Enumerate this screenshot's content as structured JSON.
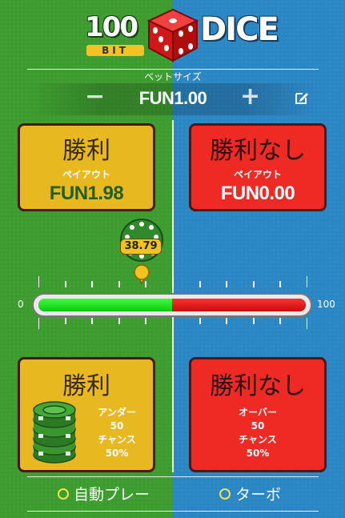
{
  "logo": {
    "number": "100",
    "bit": "BIT",
    "word": "DICE"
  },
  "bet": {
    "label": "ベットサイズ",
    "decrease_label": "−",
    "increase_label": "+",
    "value": "FUN1.00",
    "edit_icon": "edit-icon"
  },
  "win_card": {
    "title": "勝利",
    "payout_label": "ペイアウト",
    "payout_value": "FUN1.98"
  },
  "lose_card": {
    "title": "勝利なし",
    "payout_label": "ペイアウト",
    "payout_value": "FUN0.00"
  },
  "slider": {
    "value": 38.79,
    "value_label": "38.79",
    "min_label": "0",
    "max_label": "100",
    "split_fraction": 0.5,
    "win_color": "#22dd22",
    "lose_color": "#e01818"
  },
  "under_card": {
    "title": "勝利",
    "direction_label": "アンダー",
    "direction_value": "50",
    "chance_label": "チャンス",
    "chance_value": "50%"
  },
  "over_card": {
    "title": "勝利なし",
    "direction_label": "オーバー",
    "direction_value": "50",
    "chance_label": "チャンス",
    "chance_value": "50%"
  },
  "options": {
    "autoplay_label": "自動プレー",
    "turbo_label": "ターボ"
  },
  "colors": {
    "left_bg": "#3c9c2e",
    "right_bg": "#2b86c4",
    "yellow_card": "#e8b820",
    "red_card": "#ef2a24"
  }
}
